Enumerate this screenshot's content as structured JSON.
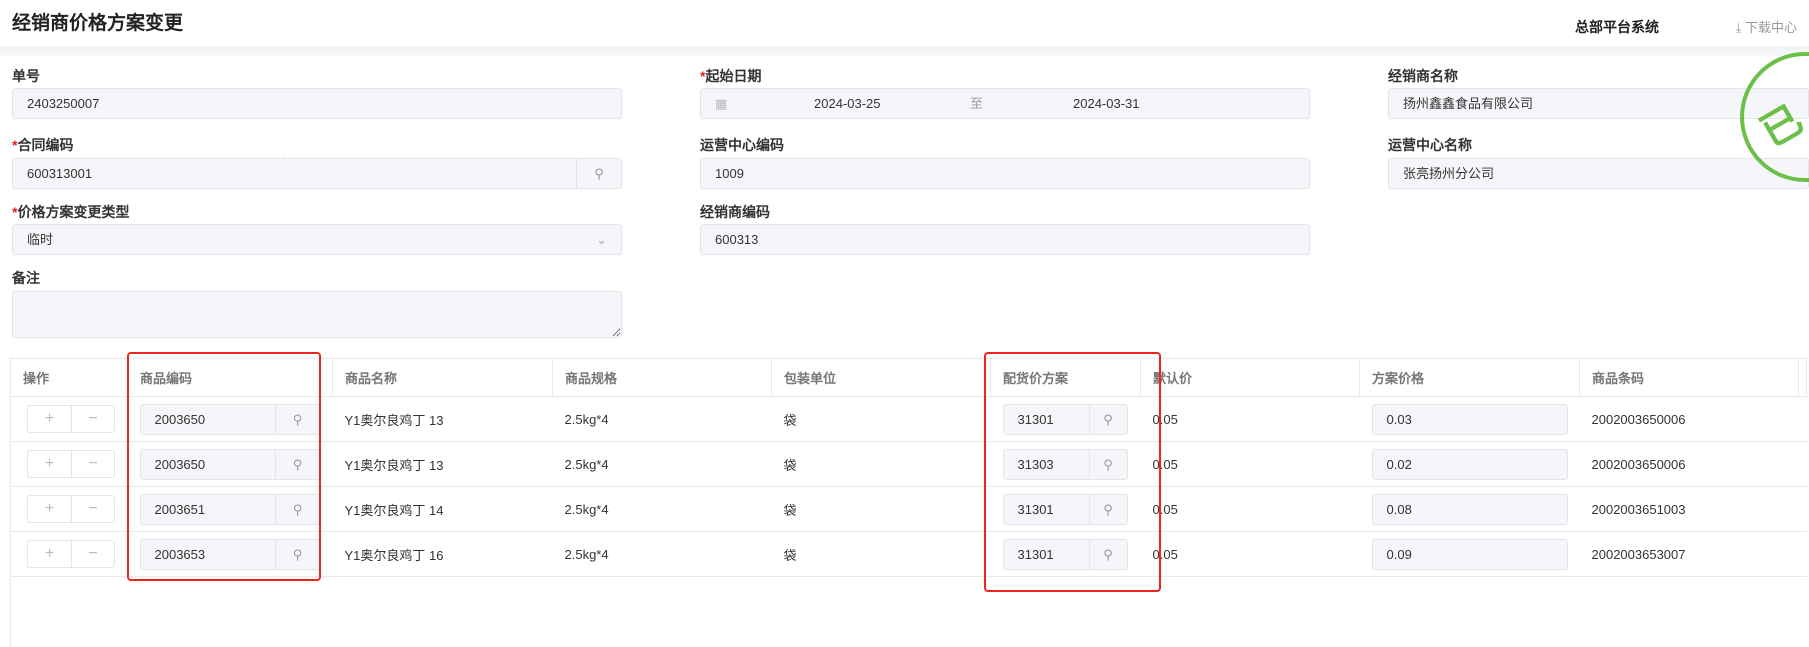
{
  "header": {
    "title": "经销商价格方案变更",
    "system": "总部平台系统",
    "download_icon": "download-icon",
    "download": "下载中心"
  },
  "form": {
    "order_no": {
      "label": "单号",
      "value": "2403250007"
    },
    "start_date": {
      "label": "起始日期",
      "from": "2024-03-25",
      "sep": "至",
      "to": "2024-03-31"
    },
    "dealer_name": {
      "label": "经销商名称",
      "value": "扬州鑫鑫食品有限公司"
    },
    "contract_code": {
      "label": "合同编码",
      "value": "600313001"
    },
    "ops_center_code": {
      "label": "运营中心编码",
      "value": "1009"
    },
    "ops_center_name": {
      "label": "运营中心名称",
      "value": "张亮扬州分公司"
    },
    "change_type": {
      "label": "价格方案变更类型",
      "value": "临时"
    },
    "dealer_code": {
      "label": "经销商编码",
      "value": "600313"
    },
    "remark": {
      "label": "备注",
      "value": ""
    },
    "required_mark": "*"
  },
  "table": {
    "headers": [
      "操作",
      "商品编码",
      "商品名称",
      "商品规格",
      "包装单位",
      "配货价方案",
      "默认价",
      "方案价格",
      "商品条码"
    ],
    "rows": [
      {
        "code": "2003650",
        "name": "Y1奥尔良鸡丁 13",
        "spec": "2.5kg*4",
        "unit": "袋",
        "plan": "31301",
        "default_price": "0.05",
        "plan_price": "0.03",
        "barcode": "2002003650006"
      },
      {
        "code": "2003650",
        "name": "Y1奥尔良鸡丁 13",
        "spec": "2.5kg*4",
        "unit": "袋",
        "plan": "31303",
        "default_price": "0.05",
        "plan_price": "0.02",
        "barcode": "2002003650006"
      },
      {
        "code": "2003651",
        "name": "Y1奥尔良鸡丁 14",
        "spec": "2.5kg*4",
        "unit": "袋",
        "plan": "31301",
        "default_price": "0.05",
        "plan_price": "0.08",
        "barcode": "2002003651003"
      },
      {
        "code": "2003653",
        "name": "Y1奥尔良鸡丁 16",
        "spec": "2.5kg*4",
        "unit": "袋",
        "plan": "31301",
        "default_price": "0.05",
        "plan_price": "0.09",
        "barcode": "2002003653007"
      }
    ]
  },
  "stamp": {
    "text": "已"
  },
  "watermark": "Yo",
  "colors": {
    "highlight": "#f0231e",
    "stamp": "#6cc04a"
  }
}
